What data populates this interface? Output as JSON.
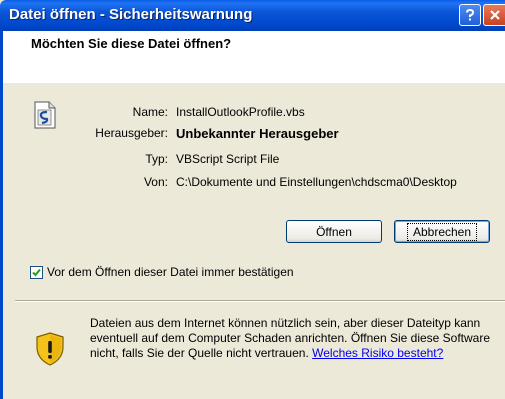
{
  "window": {
    "title": "Datei öffnen - Sicherheitswarnung",
    "help_icon": "question-icon",
    "close_icon": "close-icon"
  },
  "dialog": {
    "heading": "Möchten Sie diese Datei öffnen?",
    "file_icon": "vbscript-file-icon",
    "fields": {
      "name_label": "Name:",
      "name_value": "InstallOutlookProfile.vbs",
      "publisher_label": "Herausgeber:",
      "publisher_value": "Unbekannter Herausgeber",
      "type_label": "Typ:",
      "type_value": "VBScript Script File",
      "from_label": "Von:",
      "from_value": "C:\\Dokumente und Einstellungen\\chdscma0\\Desktop"
    },
    "buttons": {
      "open": "Öffnen",
      "cancel": "Abbrechen"
    },
    "checkbox": {
      "label": "Vor dem Öffnen dieser Datei immer bestätigen",
      "checked": true
    },
    "warning": {
      "icon": "shield-warning-icon",
      "text": "Dateien aus dem Internet können nützlich sein, aber dieser Dateityp kann eventuell auf dem Computer Schaden anrichten. Öffnen Sie diese Software nicht, falls Sie der Quelle nicht vertrauen.",
      "link": "Welches Risiko besteht?"
    }
  },
  "colors": {
    "titlebar": "#0048cc",
    "dialog_bg": "#ece9d8",
    "link": "#0000ee"
  }
}
